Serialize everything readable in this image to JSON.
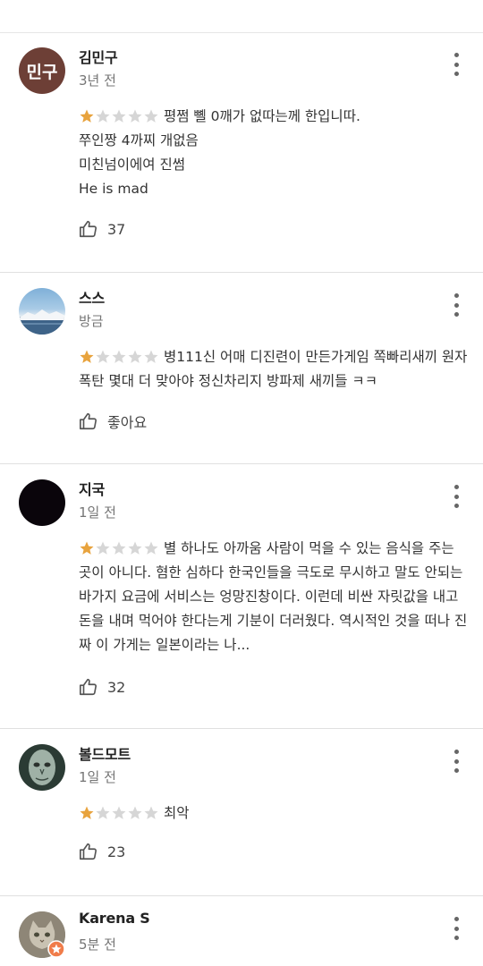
{
  "reviews": [
    {
      "name": "김민구",
      "time": "3년 전",
      "avatar_text": "민구",
      "rating": 1,
      "text": "평쩜 뼬 0깨가 없따는께 한입니따.\n쭈인짱 4까찌 개없음\n미친넘이에여 진썸\nHe is mad",
      "likes": "37"
    },
    {
      "name": "스스",
      "time": "방금",
      "rating": 1,
      "text": "병111신 어매 디진련이 만든가게임 쪽빠리새끼 원자폭탄 몇대 더 맞아야 정신차리지 방파제 새끼들 ㅋㅋ",
      "likes": "좋아요"
    },
    {
      "name": "지국",
      "time": "1일 전",
      "rating": 1,
      "text": "별 하나도 아까움 사람이 먹을 수 있는 음식을 주는 곳이 아니다. 혐한 심하다 한국인들을 극도로 무시하고 말도 안되는 바가지 요금에 서비스는 엉망진창이다. 이런데 비싼 자릿값을 내고 돈을 내며 먹어야 한다는게 기분이 더러웠다. 역시적인 것을 떠나 진짜 이 가게는 일본이라는 나...",
      "likes": "32"
    },
    {
      "name": "볼드모트",
      "time": "1일 전",
      "rating": 1,
      "text": "최악",
      "likes": "23"
    },
    {
      "name": "Karena S",
      "time": "5분 전"
    }
  ],
  "colors": {
    "star_filled": "#e8a33d",
    "star_empty": "#d6d6d6",
    "avatar_brown": "#6d3f36"
  }
}
